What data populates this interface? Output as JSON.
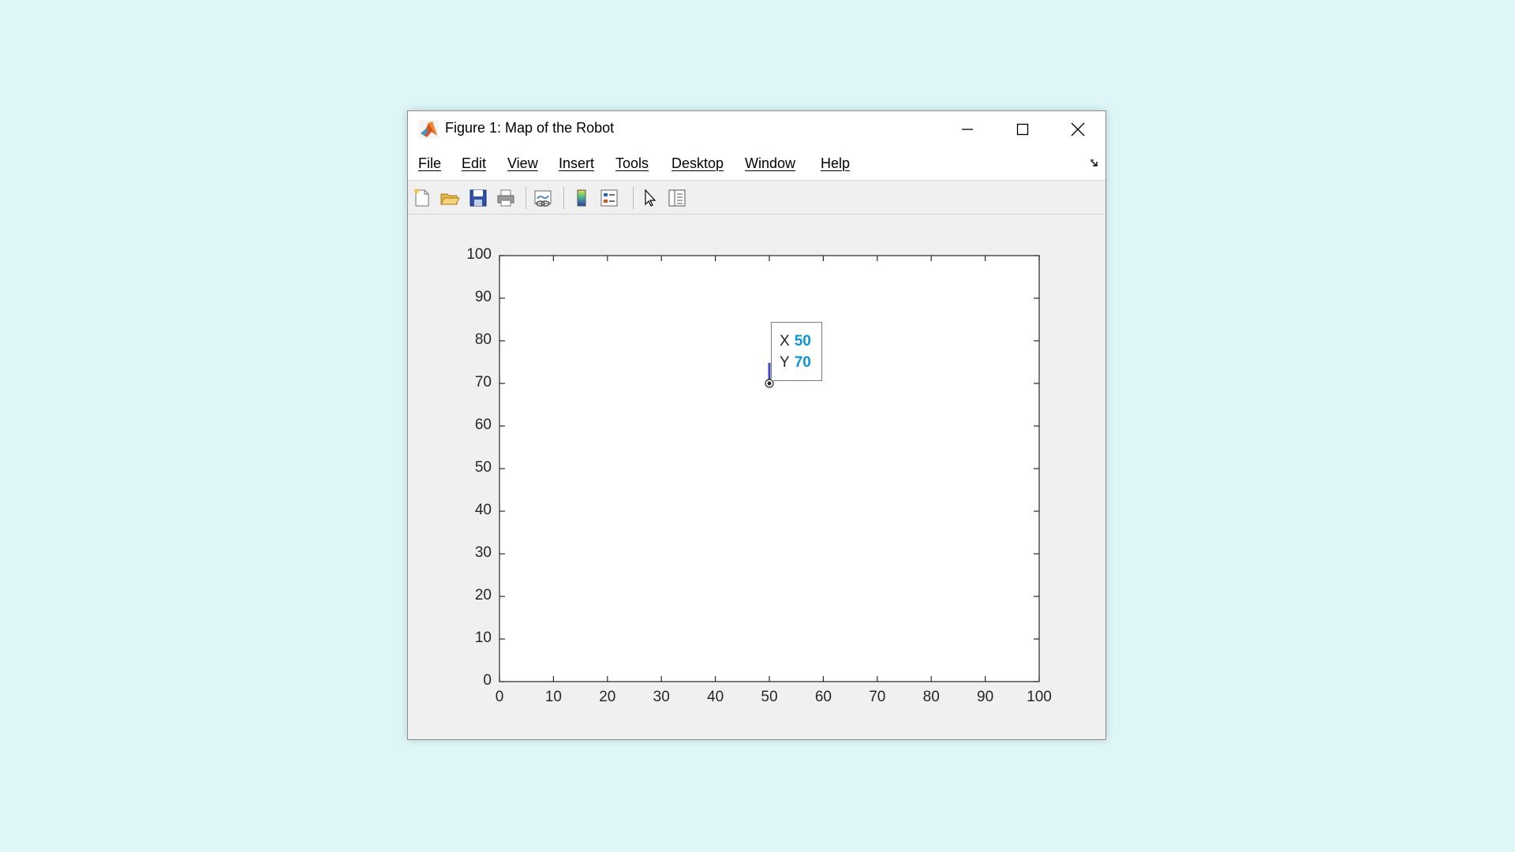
{
  "window": {
    "title": "Figure 1: Map of the Robot",
    "icon": "matlab-logo-icon",
    "controls": [
      "minimize-icon",
      "maximize-icon",
      "close-icon"
    ]
  },
  "menu": {
    "items": [
      "File",
      "Edit",
      "View",
      "Insert",
      "Tools",
      "Desktop",
      "Window",
      "Help"
    ]
  },
  "toolbar": {
    "icons": [
      "new-figure-icon",
      "open-file-icon",
      "save-icon",
      "print-icon",
      "link-plot-icon",
      "insert-colorbar-icon",
      "insert-legend-icon",
      "edit-plot-icon",
      "property-inspector-icon"
    ]
  },
  "chart_data": {
    "type": "scatter",
    "xlim": [
      0,
      100
    ],
    "ylim": [
      0,
      100
    ],
    "xticks": [
      "0",
      "10",
      "20",
      "30",
      "40",
      "50",
      "60",
      "70",
      "80",
      "90",
      "100"
    ],
    "yticks": [
      "0",
      "10",
      "20",
      "30",
      "40",
      "50",
      "60",
      "70",
      "80",
      "90",
      "100"
    ],
    "points": [
      {
        "x": 50,
        "y": 70
      }
    ],
    "grid": false,
    "datatip": {
      "x_label": "X",
      "x_value": "50",
      "y_label": "Y",
      "y_value": "70"
    }
  }
}
